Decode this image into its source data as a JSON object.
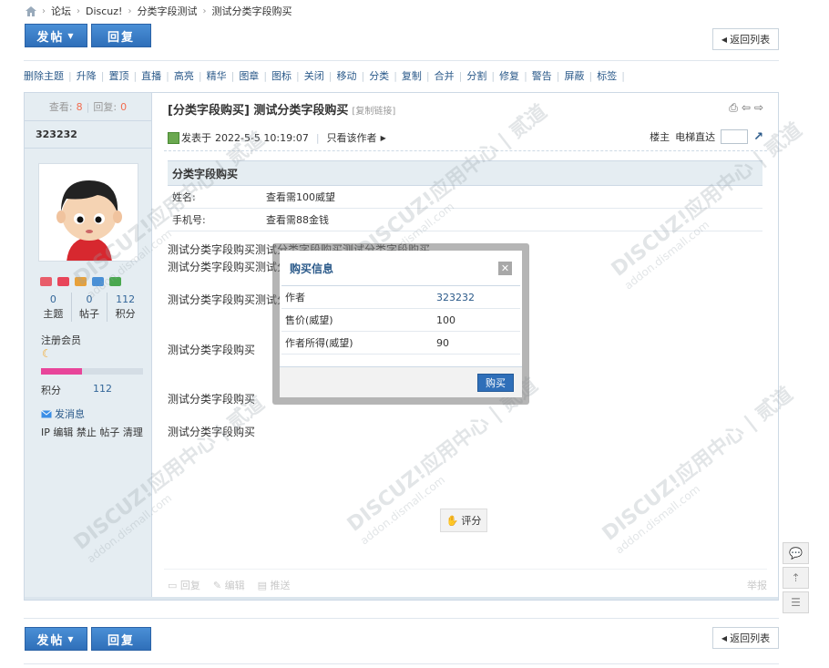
{
  "breadcrumb": {
    "items": [
      "论坛",
      "Discuz!",
      "分类字段测试",
      "测试分类字段购买"
    ]
  },
  "toolbar": {
    "post_label": "发帖",
    "reply_label": "回复",
    "back_label": "返回列表"
  },
  "modbar": {
    "items": [
      "删除主题",
      "升降",
      "置顶",
      "直播",
      "高亮",
      "精华",
      "图章",
      "图标",
      "关闭",
      "移动",
      "分类",
      "复制",
      "合并",
      "分割",
      "修复",
      "警告",
      "屏蔽",
      "标签"
    ]
  },
  "sidebar": {
    "views_label": "查看:",
    "views": "8",
    "replies_label": "回复:",
    "replies": "0",
    "username": "323232",
    "stats": [
      {
        "value": "0",
        "label": "主题"
      },
      {
        "value": "0",
        "label": "帖子"
      },
      {
        "value": "112",
        "label": "积分"
      }
    ],
    "usergroup": "注册会员",
    "progress": 0.4,
    "points_label": "积分",
    "points": "112",
    "send_message": "发消息",
    "admin_links": "IP 编辑 禁止 帖子 清理"
  },
  "post": {
    "title": "[分类字段购买] 测试分类字段购买",
    "copy_link": "[复制链接]",
    "posted_label": "发表于",
    "posted_at": "2022-5-5 10:19:07",
    "only_author": "只看该作者",
    "floor_label": "楼主",
    "elevator_label": "电梯直达",
    "category_head": "分类字段购买",
    "fields": [
      {
        "key": "姓名:",
        "value": "查看需100威望"
      },
      {
        "key": "手机号:",
        "value": "查看需88金钱"
      }
    ],
    "body_lines": [
      "测试分类字段购买测试分类字段购买测试分类字段购买",
      "测试分类字段购买测试分类字段购买",
      "测试分类字段购买测试分类字段购买",
      "测试分类字段购买",
      "测试分类字段购买",
      "测试分类字段购买"
    ],
    "rate_label": "评分",
    "actions": [
      "回复",
      "编辑",
      "推送"
    ],
    "report_label": "举报"
  },
  "modal": {
    "title": "购买信息",
    "rows": [
      {
        "key": "作者",
        "value": "323232"
      },
      {
        "key": "售价(威望)",
        "value": "100"
      },
      {
        "key": "作者所得(威望)",
        "value": "90"
      }
    ],
    "buy_label": "购买"
  },
  "watermark": {
    "brand": "DISCUZ!应用中心 | 贰道",
    "url": "addon.dismall.com"
  },
  "colors": {
    "accent": "#2f6fb9",
    "sidebar_bg": "#e5edf2",
    "progress": "#e8459a"
  }
}
